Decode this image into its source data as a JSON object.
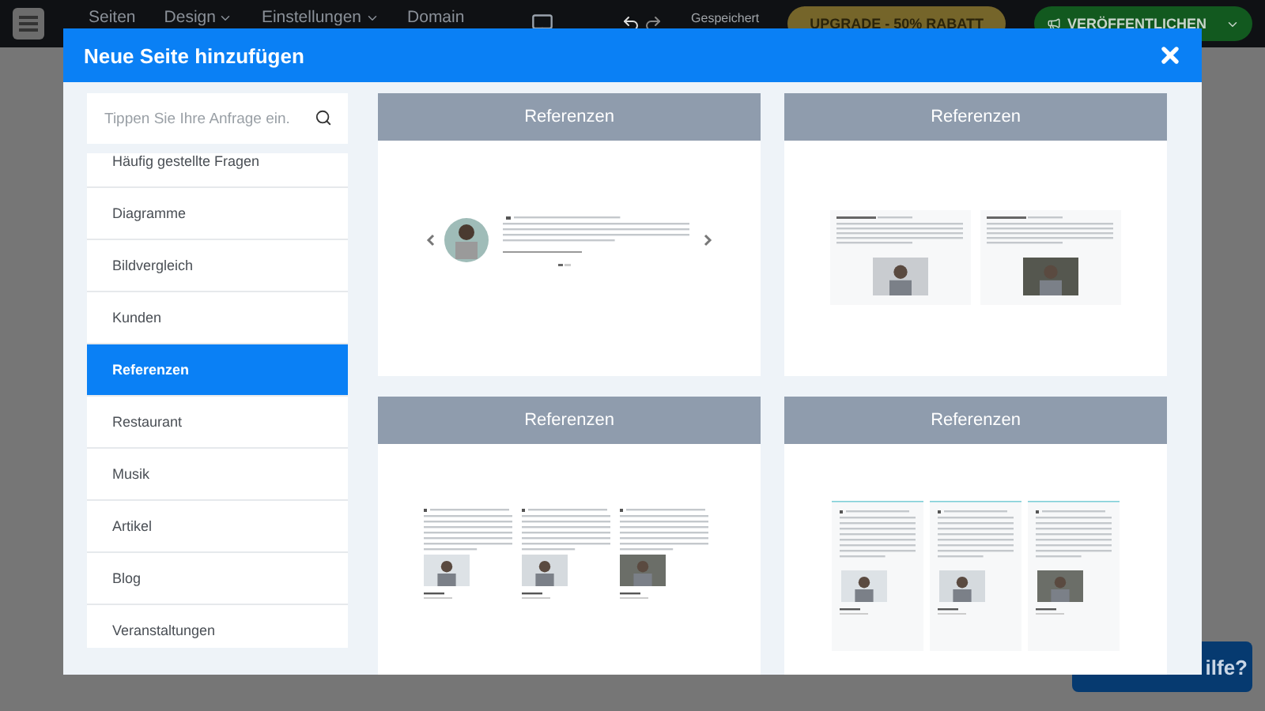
{
  "topbar": {
    "nav": [
      {
        "label": "Seiten",
        "dropdown": false
      },
      {
        "label": "Design",
        "dropdown": true
      },
      {
        "label": "Einstellungen",
        "dropdown": true
      },
      {
        "label": "Domain",
        "dropdown": false
      }
    ],
    "status": "Gespeichert",
    "upgrade_button": "UPGRADE - 50% RABATT",
    "publish_button": "VERÖFFENTLICHEN"
  },
  "dialog": {
    "title": "Neue Seite hinzufügen",
    "search": {
      "placeholder": "Tippen Sie Ihre Anfrage ein."
    },
    "categories": [
      {
        "label": "Häufig gestellte Fragen",
        "selected": false
      },
      {
        "label": "Diagramme",
        "selected": false
      },
      {
        "label": "Bildvergleich",
        "selected": false
      },
      {
        "label": "Kunden",
        "selected": false
      },
      {
        "label": "Referenzen",
        "selected": true
      },
      {
        "label": "Restaurant",
        "selected": false
      },
      {
        "label": "Musik",
        "selected": false
      },
      {
        "label": "Artikel",
        "selected": false
      },
      {
        "label": "Blog",
        "selected": false
      },
      {
        "label": "Veranstaltungen",
        "selected": false
      }
    ],
    "templates": [
      {
        "title": "Referenzen",
        "kind": "carousel"
      },
      {
        "title": "Referenzen",
        "kind": "two-cards"
      },
      {
        "title": "Referenzen",
        "kind": "three-columns"
      },
      {
        "title": "Referenzen",
        "kind": "three-boxes"
      }
    ]
  },
  "help_button": {
    "label": "ilfe?"
  }
}
